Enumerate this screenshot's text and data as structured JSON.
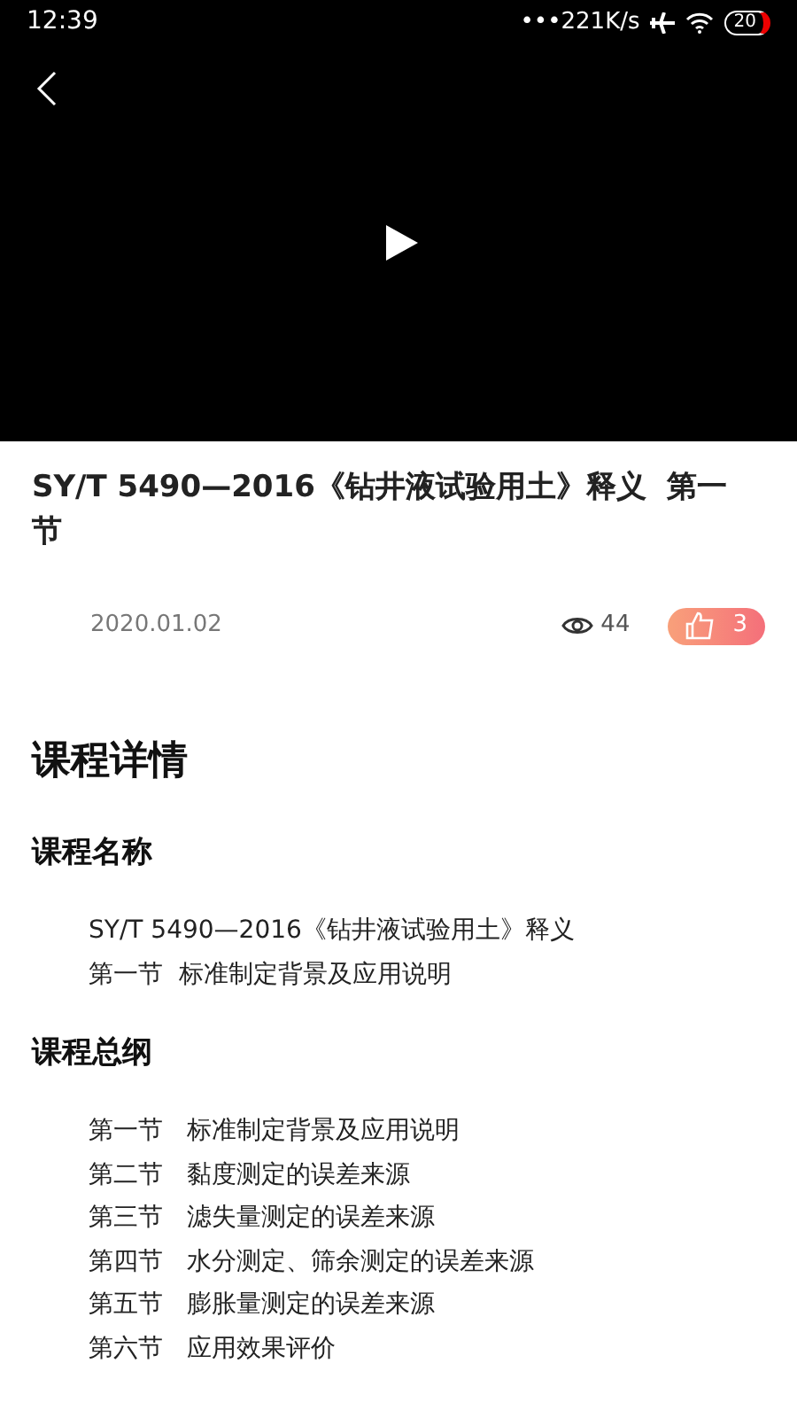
{
  "status_bar": {
    "time": "12:39",
    "network_speed": "•••221K/s",
    "battery": "20"
  },
  "title": "SY/T 5490—2016《钻井液试验用土》释义  第一节",
  "meta": {
    "date": "2020.01.02",
    "views": "44",
    "likes": "3"
  },
  "details_heading": "课程详情",
  "sections": [
    {
      "heading": "课程名称",
      "lines": [
        "SY/T 5490—2016《钻井液试验用土》释义",
        "第一节  标准制定背景及应用说明"
      ]
    },
    {
      "heading": "课程总纲",
      "lines": [
        "第一节   标准制定背景及应用说明",
        "第二节   黏度测定的误差来源",
        "第三节   滤失量测定的误差来源",
        "第四节   水分测定、筛余测定的误差来源",
        "第五节   膨胀量测定的误差来源",
        "第六节   应用效果评价"
      ]
    }
  ]
}
